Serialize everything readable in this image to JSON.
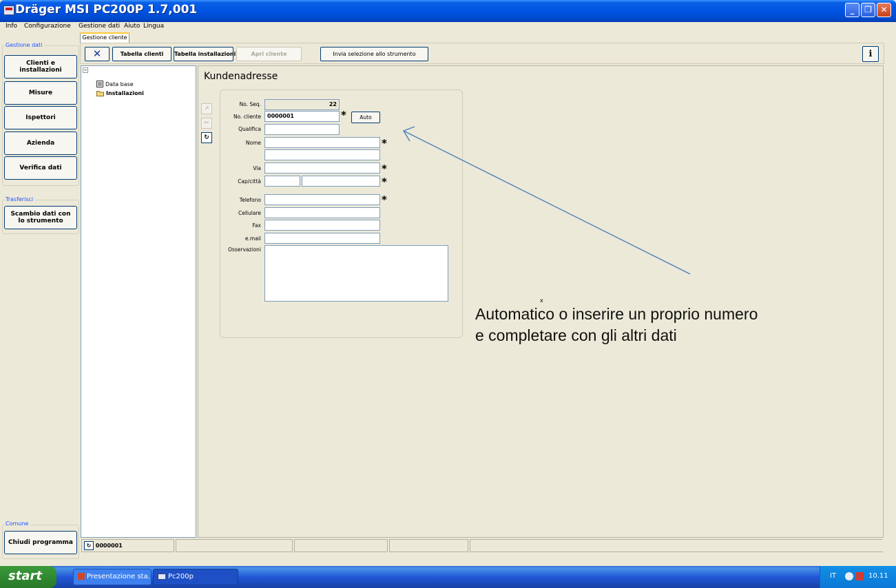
{
  "window": {
    "title": "Dräger MSI PC200P 1.7,001",
    "controls": {
      "minimize": "_",
      "maximize": "❐",
      "close": "✕"
    }
  },
  "menu": [
    "Info",
    "Configurazione",
    "Gestione dati",
    "Aiuto",
    "Lingua"
  ],
  "tab": {
    "label": "Gestione cliente"
  },
  "left_panel": {
    "group_data": {
      "label": "Gestione dati",
      "buttons": [
        "Clienti e installazioni",
        "Misure",
        "Ispettori",
        "Azienda",
        "Verifica dati"
      ]
    },
    "group_transfer": {
      "label": "Trasferisci",
      "buttons": [
        "Scambio dati con lo strumento"
      ]
    },
    "group_common": {
      "label": "Comune",
      "buttons": [
        "Chiudi programma"
      ]
    }
  },
  "toolbar": {
    "close_icon": "✕",
    "customers_table": "Tabella clienti",
    "installations_table": "Tabella installazioni",
    "open_customer": "Apri cliente",
    "send_selection": "Invia selezione allo strumento",
    "info_icon": "ℹ"
  },
  "tree": {
    "collapse": "−",
    "items": [
      {
        "label": "Data base",
        "icon": "database-icon"
      },
      {
        "label": "Installazioni",
        "icon": "folder-icon"
      }
    ]
  },
  "form": {
    "title": "Kundenadresse",
    "side_buttons": [
      "↗",
      "✂",
      "↻"
    ],
    "labels": {
      "seq": "No. Seq.",
      "customer_no": "No. cliente",
      "qualifica": "Qualifica",
      "nome": "Nome",
      "via": "Via",
      "cap": "Cap/città",
      "telefono": "Telefono",
      "cellulare": "Cellulare",
      "fax": "Fax",
      "email": "e.mail",
      "osservazioni": "Osservazioni"
    },
    "values": {
      "seq": "22",
      "customer_no": "0000001",
      "qualifica": "",
      "nome_1": "",
      "nome_2": "",
      "via": "",
      "cap": "",
      "citta": "",
      "telefono": "",
      "cellulare": "",
      "fax": "",
      "email": "",
      "osservazioni": ""
    },
    "auto_button": "Auto",
    "required_mark": "*"
  },
  "annotation": {
    "marker": "x",
    "line1": "Automatico o inserire un proprio numero",
    "line2": "e completare con gli altri dati",
    "color": "#4a7ebb"
  },
  "statusbar": {
    "refresh_icon": "↻",
    "record": "0000001"
  },
  "taskbar": {
    "start": "start",
    "items": [
      "Presentazione sta...",
      "Pc200p"
    ],
    "language": "IT",
    "clock": "10.11"
  }
}
